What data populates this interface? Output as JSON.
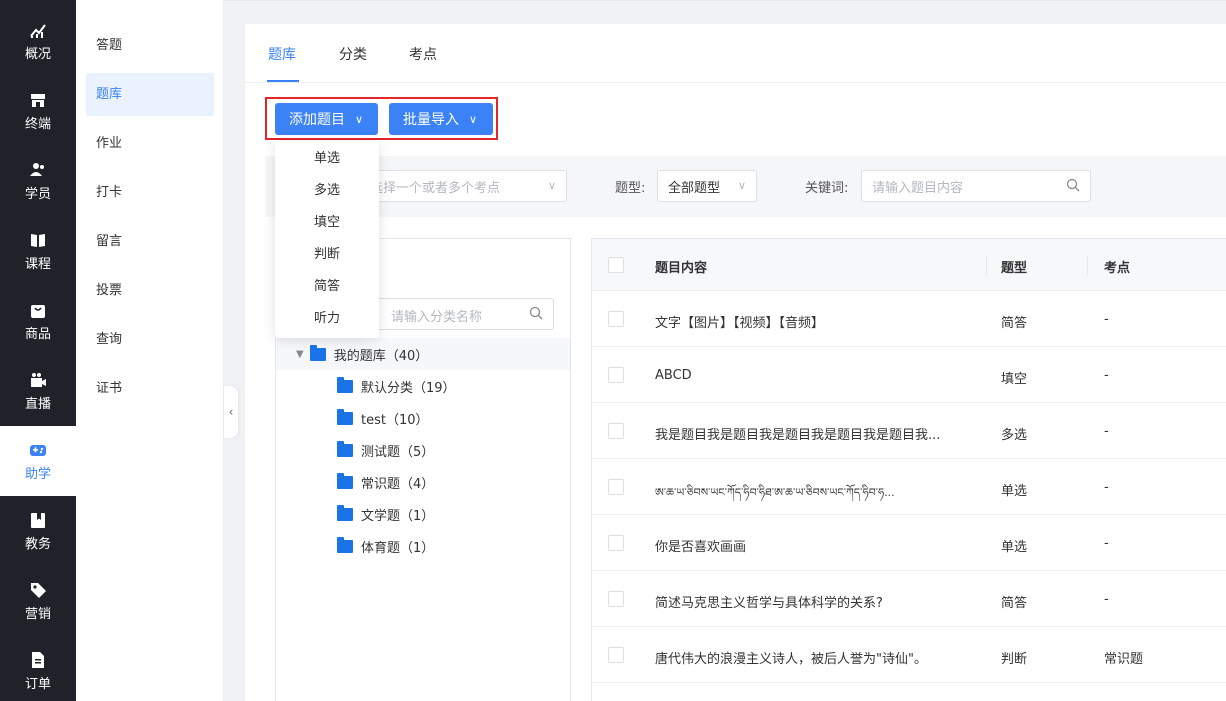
{
  "nav": [
    {
      "label": "概况",
      "icon": "chart-icon"
    },
    {
      "label": "终端",
      "icon": "store-icon"
    },
    {
      "label": "学员",
      "icon": "users-icon"
    },
    {
      "label": "课程",
      "icon": "book-icon"
    },
    {
      "label": "商品",
      "icon": "bag-icon"
    },
    {
      "label": "直播",
      "icon": "camera-icon"
    },
    {
      "label": "助学",
      "icon": "gamepad-icon"
    },
    {
      "label": "教务",
      "icon": "bookmark-icon"
    },
    {
      "label": "营销",
      "icon": "tag-icon"
    },
    {
      "label": "订单",
      "icon": "document-icon"
    }
  ],
  "submenu": [
    "答题",
    "题库",
    "作业",
    "打卡",
    "留言",
    "投票",
    "查询",
    "证书"
  ],
  "tabs": [
    "题库",
    "分类",
    "考点"
  ],
  "buttons": {
    "add": "添加题目",
    "import": "批量导入"
  },
  "dropdown": [
    "单选",
    "多选",
    "填空",
    "判断",
    "简答",
    "听力"
  ],
  "filters": {
    "knowledge_placeholder": "选择一个或者多个考点",
    "type_label": "题型:",
    "type_value": "全部题型",
    "keyword_label": "关键词:",
    "keyword_placeholder": "请输入题目内容"
  },
  "tree": {
    "search_placeholder": "请输入分类名称",
    "root": "我的题库（40）",
    "children": [
      "默认分类（19）",
      "test（10）",
      "测试题（5）",
      "常识题（4）",
      "文学题（1）",
      "体育题（1）"
    ]
  },
  "table": {
    "headers": [
      "题目内容",
      "题型",
      "考点"
    ],
    "rows": [
      {
        "content": "文字【图片】【视频】【音频】",
        "type": "简答",
        "point": "-"
      },
      {
        "content": "ABCD",
        "type": "填空",
        "point": "-"
      },
      {
        "content": "我是题目我是题目我是题目我是题目我是题目我...",
        "type": "多选",
        "point": "-"
      },
      {
        "content": "ཨ་ཆ་ཡ་ཅིབས་ཡང་ཀོད་ཧིབ་ཧིཐ་ཨ་ཆ་ཡ་ཅིབས་ཡང་ཀོད་ཧིབ་ཧ...",
        "type": "单选",
        "point": "-"
      },
      {
        "content": "你是否喜欢画画",
        "type": "单选",
        "point": "-"
      },
      {
        "content": "简述马克思主义哲学与具体科学的关系?",
        "type": "简答",
        "point": "-"
      },
      {
        "content": "唐代伟大的浪漫主义诗人，被后人誉为\"诗仙\"。",
        "type": "判断",
        "point": "常识题"
      }
    ]
  },
  "colors": {
    "accent": "#3b82f6",
    "nav_bg": "#1f2229",
    "highlight": "#e5242b"
  }
}
